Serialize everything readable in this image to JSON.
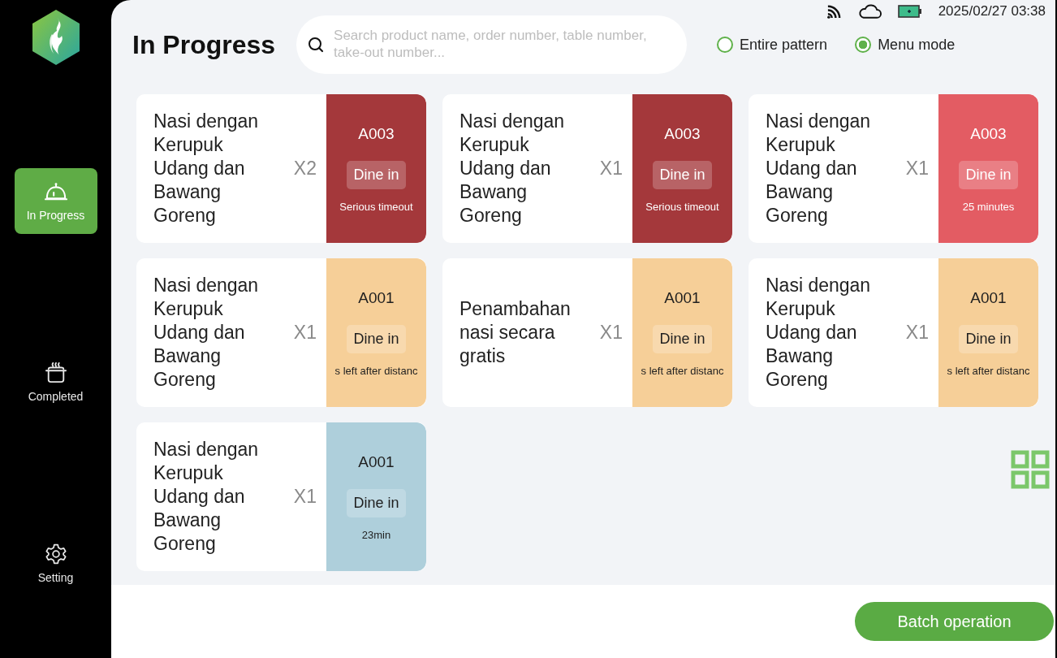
{
  "sidebar": {
    "items": [
      {
        "label": "In Progress",
        "selected": true
      },
      {
        "label": "Completed",
        "selected": false
      },
      {
        "label": "Setting",
        "selected": false
      }
    ]
  },
  "status_bar": {
    "datetime": "2025/02/27 03:38"
  },
  "header": {
    "title": "In Progress",
    "search": {
      "placeholder": "Search product name, order number, table number, take-out number..."
    },
    "modes": [
      {
        "label": "Entire pattern",
        "selected": false
      },
      {
        "label": "Menu mode",
        "selected": true
      }
    ]
  },
  "orders": [
    {
      "product": "Nasi dengan Kerupuk Udang dan Bawang Goreng",
      "quantity": "X2",
      "order_number": "A003",
      "dining": "Dine in",
      "status": "Serious timeout",
      "color": "#a4383b"
    },
    {
      "product": "Nasi dengan Kerupuk Udang dan Bawang Goreng",
      "quantity": "X1",
      "order_number": "A003",
      "dining": "Dine in",
      "status": "Serious timeout",
      "color": "#a4383b"
    },
    {
      "product": "Nasi dengan Kerupuk Udang dan Bawang Goreng",
      "quantity": "X1",
      "order_number": "A003",
      "dining": "Dine in",
      "status": "25 minutes",
      "color": "#e35c63"
    },
    {
      "product": "Nasi dengan Kerupuk Udang dan Bawang Goreng",
      "quantity": "X1",
      "order_number": "A001",
      "dining": "Dine in",
      "status": "s left after distanc",
      "color": "#f6cf98"
    },
    {
      "product": "Penambahan nasi secara gratis",
      "quantity": "X1",
      "order_number": "A001",
      "dining": "Dine in",
      "status": "s left after distanc",
      "color": "#f6cf98"
    },
    {
      "product": "Nasi dengan Kerupuk Udang dan Bawang Goreng",
      "quantity": "X1",
      "order_number": "A001",
      "dining": "Dine in",
      "status": "s left after distanc",
      "color": "#f6cf98"
    },
    {
      "product": "Nasi dengan Kerupuk Udang dan Bawang Goreng",
      "quantity": "X1",
      "order_number": "A001",
      "dining": "Dine in",
      "status": "23min",
      "color": "#aecfdb"
    }
  ],
  "footer": {
    "button": "Batch operation"
  }
}
